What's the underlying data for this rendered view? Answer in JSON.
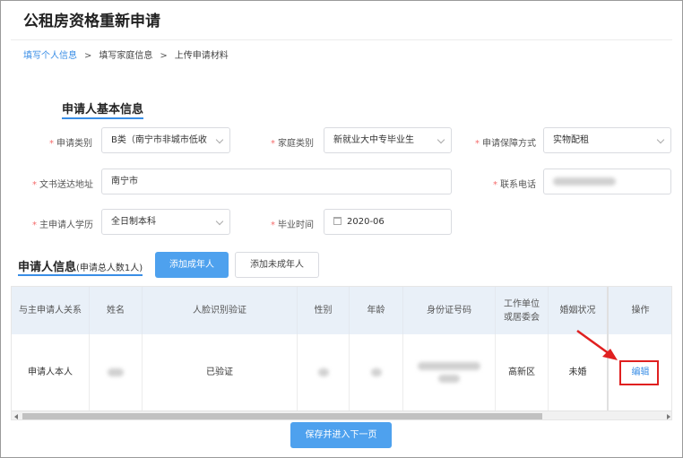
{
  "page": {
    "title": "公租房资格重新申请"
  },
  "breadcrumb": {
    "step1": "填写个人信息",
    "step2": "填写家庭信息",
    "step3": "上传申请材料",
    "separator": ">"
  },
  "basic_info": {
    "section_title": "申请人基本信息",
    "required_mark": "*",
    "apply_category": {
      "label": "申请类别",
      "value": "B类（南宁市非城市低收"
    },
    "family_category": {
      "label": "家庭类别",
      "value": "新就业大中专毕业生"
    },
    "guarantee_method": {
      "label": "申请保障方式",
      "value": "实物配租"
    },
    "document_address": {
      "label": "文书送达地址",
      "value": "南宁市"
    },
    "phone": {
      "label": "联系电话"
    },
    "education": {
      "label": "主申请人学历",
      "value": "全日制本科"
    },
    "graduation_time": {
      "label": "毕业时间",
      "value": "2020-06"
    }
  },
  "applicant_info": {
    "title": "申请人信息",
    "count_note": "(申请总人数1人)",
    "add_adult_label": "添加成年人",
    "add_minor_label": "添加未成年人"
  },
  "table": {
    "headers": {
      "relation": "与主申请人关系",
      "name": "姓名",
      "face_verify": "人脸识别验证",
      "gender": "性别",
      "age": "年龄",
      "id_number": "身份证号码",
      "work_unit_line1": "工作单位",
      "work_unit_line2": "或居委会",
      "marital": "婚姻状况",
      "action": "操作"
    },
    "row": {
      "relation": "申请人本人",
      "face_verify": "已验证",
      "work_unit": "高新区",
      "marital": "未婚",
      "action": "编辑"
    }
  },
  "footer": {
    "save_label": "保存并进入下一页"
  },
  "colors": {
    "accent": "#3a8ee6",
    "button_blue": "#4ea1ee",
    "required_red": "#f56c6c",
    "annotation_red": "#e02020"
  }
}
